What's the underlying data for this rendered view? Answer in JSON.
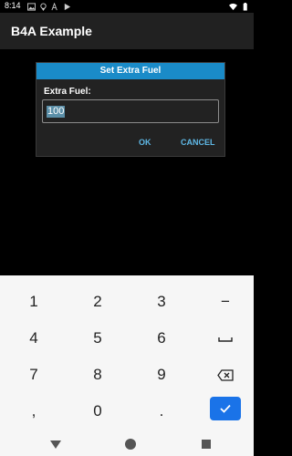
{
  "status_bar": {
    "time": "8:14",
    "left_icons": [
      "image-icon",
      "location-icon",
      "font-icon",
      "play-store-icon"
    ],
    "right_icons": [
      "wifi-icon",
      "battery-icon"
    ]
  },
  "app_bar": {
    "title": "B4A Example"
  },
  "dialog": {
    "title": "Set Extra Fuel",
    "field_label": "Extra Fuel:",
    "field_value": "100",
    "ok_label": "OK",
    "cancel_label": "CANCEL",
    "title_color": "#1a8bc8",
    "button_color": "#5fb8e6"
  },
  "keyboard": {
    "rows": [
      [
        "1",
        "2",
        "3",
        "−"
      ],
      [
        "4",
        "5",
        "6",
        "space-icon"
      ],
      [
        "7",
        "8",
        "9",
        "backspace-icon"
      ],
      [
        ",",
        "0",
        ".",
        "enter-check-icon"
      ]
    ],
    "accent_color": "#1a73e8"
  },
  "nav_bar": {
    "buttons": [
      "back-icon",
      "home-icon",
      "recents-icon"
    ]
  }
}
